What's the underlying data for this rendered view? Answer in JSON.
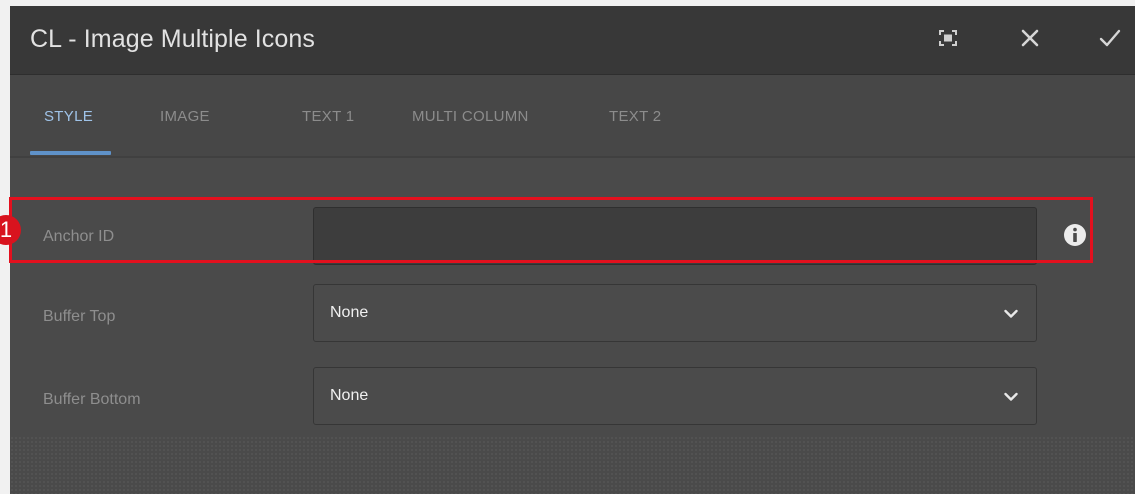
{
  "dialog": {
    "title": "CL - Image Multiple Icons",
    "actions": [
      {
        "name": "fullscreen-icon"
      },
      {
        "name": "close-icon"
      },
      {
        "name": "check-icon"
      }
    ]
  },
  "tabs": [
    {
      "label": "STYLE",
      "active": true
    },
    {
      "label": "IMAGE",
      "active": false
    },
    {
      "label": "TEXT 1",
      "active": false
    },
    {
      "label": "MULTI COLUMN",
      "active": false
    },
    {
      "label": "TEXT 2",
      "active": false
    }
  ],
  "form": {
    "anchor_id": {
      "label": "Anchor ID",
      "value": "",
      "info_icon": "info-icon"
    },
    "buffer_top": {
      "label": "Buffer Top",
      "selected": "None"
    },
    "buffer_bottom": {
      "label": "Buffer Bottom",
      "selected": "None"
    }
  },
  "annotation": {
    "number": "1",
    "color": "#e3101e"
  },
  "colors": {
    "accent": "#5f92c9",
    "highlight": "#e3101e"
  }
}
